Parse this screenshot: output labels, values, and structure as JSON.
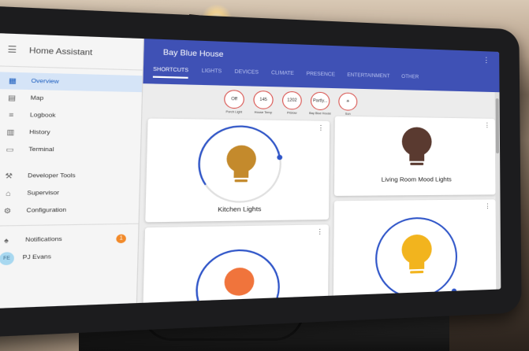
{
  "sidebar": {
    "app_title": "Home Assistant",
    "items": [
      {
        "label": "Overview",
        "icon": "overview-icon",
        "active": true
      },
      {
        "label": "Map",
        "icon": "map-icon"
      },
      {
        "label": "Logbook",
        "icon": "logbook-icon"
      },
      {
        "label": "History",
        "icon": "history-icon"
      },
      {
        "label": "Terminal",
        "icon": "terminal-icon"
      }
    ],
    "items_lower": [
      {
        "label": "Developer Tools",
        "icon": "hammer-icon"
      },
      {
        "label": "Supervisor",
        "icon": "supervisor-icon"
      },
      {
        "label": "Configuration",
        "icon": "gear-icon"
      }
    ],
    "notifications_label": "Notifications",
    "notifications_count": "1",
    "user_initials": "FE",
    "user_name": "PJ Evans"
  },
  "header": {
    "title": "Bay Blue House",
    "tabs": [
      "SHORTCUTS",
      "LIGHTS",
      "DEVICES",
      "CLIMATE",
      "PRESENCE",
      "ENTERTAINMENT",
      "OTHER"
    ]
  },
  "chips": [
    {
      "value": "Off",
      "label": "Porch Light"
    },
    {
      "value": "145",
      "label": "House Temp"
    },
    {
      "value": "1202",
      "label": "PiGlow"
    },
    {
      "value": "Partly...",
      "label": "Bay Blue House"
    },
    {
      "value": "☀",
      "label": "Sun"
    }
  ],
  "cards": [
    {
      "name": "Kitchen Lights",
      "bulb_color": "#c48a2c"
    },
    {
      "name": "Living Room Mood Lights",
      "bulb_color": "#5a3a30"
    },
    {
      "name": "",
      "bulb_color": "#f0743c"
    },
    {
      "name": "",
      "bulb_color": "#f2b41e"
    }
  ],
  "colors": {
    "header": "#3f51b5",
    "accent_ring": "#2f55c8",
    "active_item": "#1e5fbf",
    "badge": "#f28a2a"
  }
}
